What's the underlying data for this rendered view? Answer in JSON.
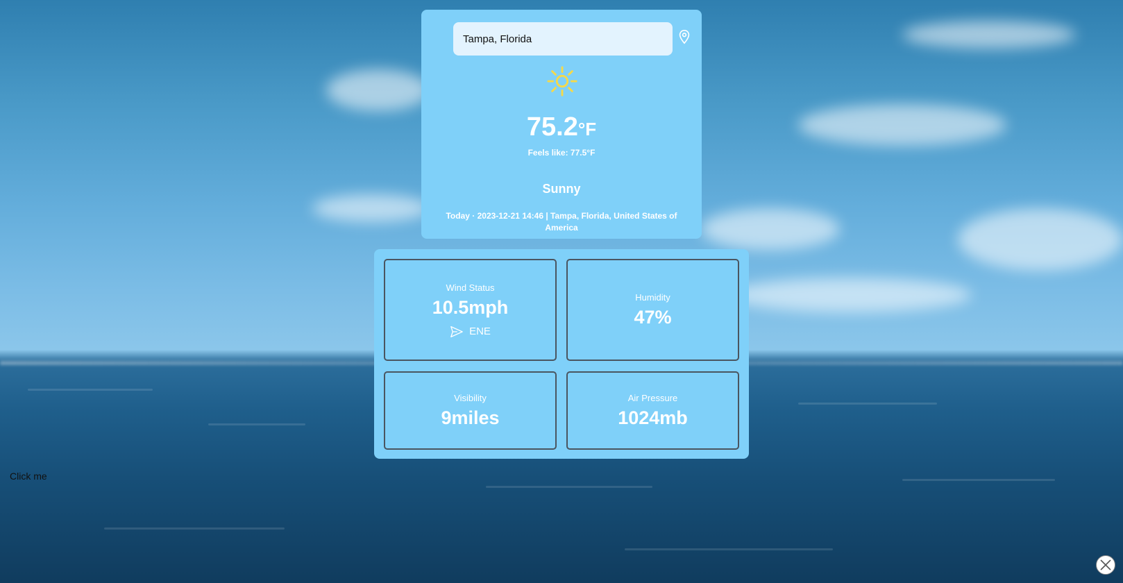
{
  "search": {
    "value": "Tampa, Florida"
  },
  "weather": {
    "icon": "sun-icon",
    "temperature": "75.2",
    "unit": "°F",
    "feels_like": "Feels like: 77.5°F",
    "condition": "Sunny",
    "date_location": "Today · 2023-12-21 14:46 | Tampa, Florida, United States of America"
  },
  "stats": {
    "wind": {
      "label": "Wind Status",
      "value": "10.5mph",
      "direction": "ENE"
    },
    "humidity": {
      "label": "Humidity",
      "value": "47%"
    },
    "visibility": {
      "label": "Visibility",
      "value": "9miles"
    },
    "pressure": {
      "label": "Air Pressure",
      "value": "1024mb"
    }
  },
  "click_me": "Click me",
  "colors": {
    "card": "#7fd0f9",
    "input": "#e3f3fe",
    "sun": "#f5d94a",
    "border": "#4a5560"
  }
}
